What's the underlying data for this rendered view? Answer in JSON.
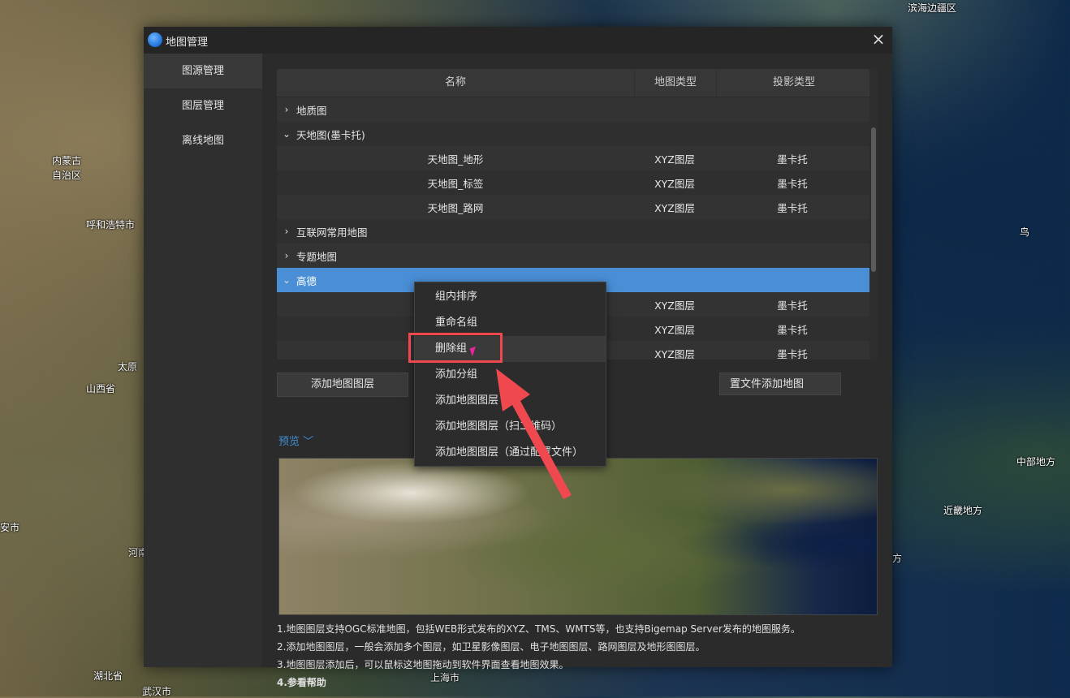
{
  "background_map": {
    "labels": [
      "滨海边疆区",
      "内蒙古",
      "自治区",
      "呼和浩特市",
      "太原",
      "山西省",
      "安市",
      "河南",
      "湖北省",
      "武汉市",
      "上海市",
      "中部地方",
      "近畿地方",
      "方",
      "鸟"
    ]
  },
  "dialog": {
    "title": "地图管理",
    "close_symbol": "×",
    "sidebar": [
      {
        "label": "图源管理",
        "active": true
      },
      {
        "label": "图层管理",
        "active": false
      },
      {
        "label": "离线地图",
        "active": false
      }
    ],
    "table": {
      "headers": {
        "name": "名称",
        "map_type": "地图类型",
        "projection": "投影类型"
      },
      "rows": [
        {
          "kind": "group",
          "expanded": false,
          "name": "地质图"
        },
        {
          "kind": "group",
          "expanded": true,
          "name": "天地图(墨卡托)"
        },
        {
          "kind": "item",
          "name": "天地图_地形",
          "map_type": "XYZ图层",
          "projection": "墨卡托"
        },
        {
          "kind": "item",
          "name": "天地图_标签",
          "map_type": "XYZ图层",
          "projection": "墨卡托"
        },
        {
          "kind": "item",
          "name": "天地图_路网",
          "map_type": "XYZ图层",
          "projection": "墨卡托"
        },
        {
          "kind": "group",
          "expanded": false,
          "name": "互联网常用地图"
        },
        {
          "kind": "group",
          "expanded": false,
          "name": "专题地图"
        },
        {
          "kind": "group",
          "expanded": true,
          "selected": true,
          "name": "高德"
        },
        {
          "kind": "item",
          "name": "",
          "map_type": "XYZ图层",
          "projection": "墨卡托"
        },
        {
          "kind": "item",
          "name": "",
          "map_type": "XYZ图层",
          "projection": "墨卡托"
        },
        {
          "kind": "item",
          "name": "",
          "map_type": "XYZ图层",
          "projection": "墨卡托"
        }
      ]
    },
    "buttons": {
      "add_map_layer": "添加地图图层",
      "add_by_config": "置文件添加地图"
    },
    "preview_label": "预览",
    "notes": [
      "1.地图图层支持OGC标准地图，包括WEB形式发布的XYZ、TMS、WMTS等，也支持Bigemap Server发布的地图服务。",
      "2.添加地图图层，一般会添加多个图层，如卫星影像图层、电子地图图层、路网图层及地形图图层。",
      "3.地图图层添加后，可以鼠标这地图拖动到软件界面查看地图效果。",
      "4.参看帮助"
    ]
  },
  "context_menu": {
    "items": [
      "组内排序",
      "重命名组",
      "删除组",
      "添加分组",
      "添加地图图层",
      "添加地图图层（扫二维码）",
      "添加地图图层（通过配置文件）"
    ],
    "hovered_index": 2
  },
  "colors": {
    "selection": "#4a8ed6",
    "highlight_box": "#f0484f",
    "pointer_arrow": "#f0484f",
    "link": "#3f8fd8"
  }
}
